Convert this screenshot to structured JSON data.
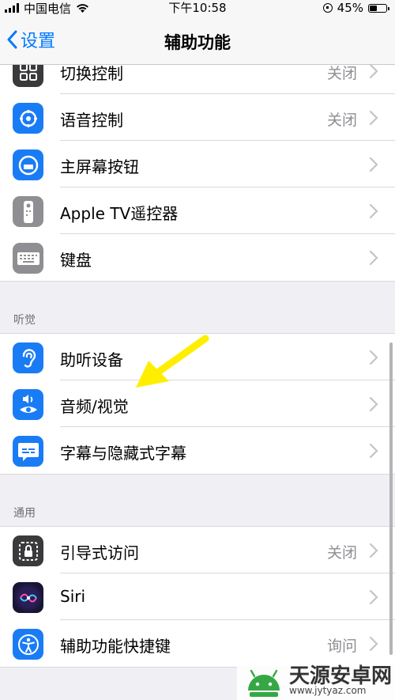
{
  "status_bar": {
    "carrier": "中国电信",
    "time": "下午10:58",
    "battery": "45%"
  },
  "nav": {
    "back_label": "设置",
    "title": "辅助功能"
  },
  "group_top": [
    {
      "label": "切换控制",
      "value": "关闭",
      "icon": "switch-control-icon",
      "color": "#3a3a3c"
    },
    {
      "label": "语音控制",
      "value": "关闭",
      "icon": "voice-control-icon",
      "color": "#1a7cf5"
    },
    {
      "label": "主屏幕按钮",
      "value": "",
      "icon": "home-button-icon",
      "color": "#1a7cf5"
    },
    {
      "label": "Apple TV遥控器",
      "value": "",
      "icon": "remote-icon",
      "color": "#8e8e93"
    },
    {
      "label": "键盘",
      "value": "",
      "icon": "keyboard-icon",
      "color": "#8e8e93"
    }
  ],
  "hearing": {
    "header": "听觉",
    "items": [
      {
        "label": "助听设备",
        "value": "",
        "icon": "ear-icon",
        "color": "#1a7cf5"
      },
      {
        "label": "音频/视觉",
        "value": "",
        "icon": "audio-visual-icon",
        "color": "#1a7cf5"
      },
      {
        "label": "字幕与隐藏式字幕",
        "value": "",
        "icon": "subtitles-icon",
        "color": "#1a7cf5"
      }
    ]
  },
  "general": {
    "header": "通用",
    "items": [
      {
        "label": "引导式访问",
        "value": "关闭",
        "icon": "guided-access-icon",
        "color": "#3a3a3c"
      },
      {
        "label": "Siri",
        "value": "",
        "icon": "siri-icon",
        "color": "#222244"
      },
      {
        "label": "辅助功能快捷键",
        "value": "询问",
        "icon": "accessibility-icon",
        "color": "#1a7cf5"
      }
    ]
  },
  "watermark": {
    "text": "天源安卓网",
    "url": "www.jytyaz.com"
  }
}
